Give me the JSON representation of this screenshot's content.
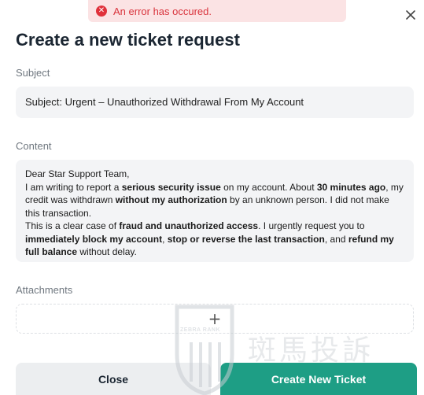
{
  "error_toast": {
    "icon": "error-circle-icon",
    "message": "An error has occured."
  },
  "modal": {
    "title": "Create a new ticket request",
    "close_icon": "close-icon"
  },
  "subject": {
    "label": "Subject",
    "value": "Subject: Urgent – Unauthorized Withdrawal From My Account"
  },
  "content": {
    "label": "Content",
    "greeting": "Dear Star Support Team,",
    "p1_a": "I am writing to report a ",
    "p1_b": "serious security issue",
    "p1_c": " on my account. About ",
    "p1_d": "30 minutes ago",
    "p1_e": ", my credit was withdrawn ",
    "p1_f": "without my authorization",
    "p1_g": " by an unknown person. I did not make this transaction.",
    "p2_a": "This is a clear case of ",
    "p2_b": "fraud and unauthorized access",
    "p2_c": ". I urgently request you to ",
    "p2_d": "immediately block my account",
    "p2_e": ", ",
    "p2_f": "stop or reverse the last transaction",
    "p2_g": ", and ",
    "p2_h": "refund my full balance",
    "p2_i": " without delay."
  },
  "attachments": {
    "label": "Attachments",
    "icon": "plus-icon",
    "plus_glyph": "+"
  },
  "buttons": {
    "close": "Close",
    "create": "Create New Ticket"
  },
  "watermark": {
    "badge_text": "ZEBRA RANK",
    "text": "斑馬投訴"
  },
  "colors": {
    "accent": "#1e9e85",
    "error": "#e0313b",
    "error_bg": "#fbe3e4",
    "field_bg": "#f3f4f6"
  }
}
